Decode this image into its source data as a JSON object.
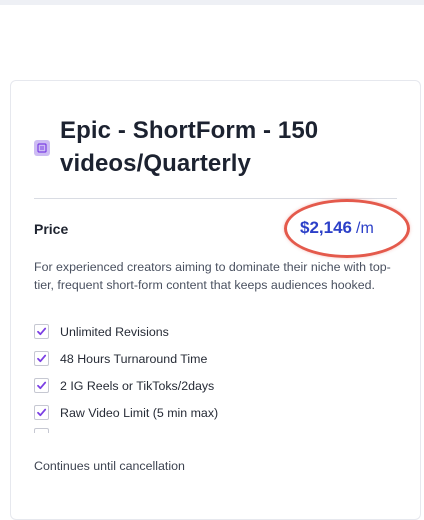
{
  "plan": {
    "icon": "receipt-icon",
    "title": "Epic - ShortForm - 150 videos/Quarterly",
    "price_label": "Price",
    "price_amount": "$2,146",
    "price_period": "/m",
    "description": "For experienced creators aiming to dominate their niche with top-tier, frequent short-form content that keeps audiences hooked.",
    "features": [
      "Unlimited Revisions",
      "48 Hours Turnaround Time",
      "2 IG Reels or TikToks/2days",
      "Raw Video Limit (5 min max)"
    ],
    "footer": "Continues until cancellation"
  },
  "colors": {
    "accent": "#2c40c8",
    "check": "#7b3fe4",
    "highlight": "#e45a4c",
    "icon_bg": "#cdbcf3"
  }
}
